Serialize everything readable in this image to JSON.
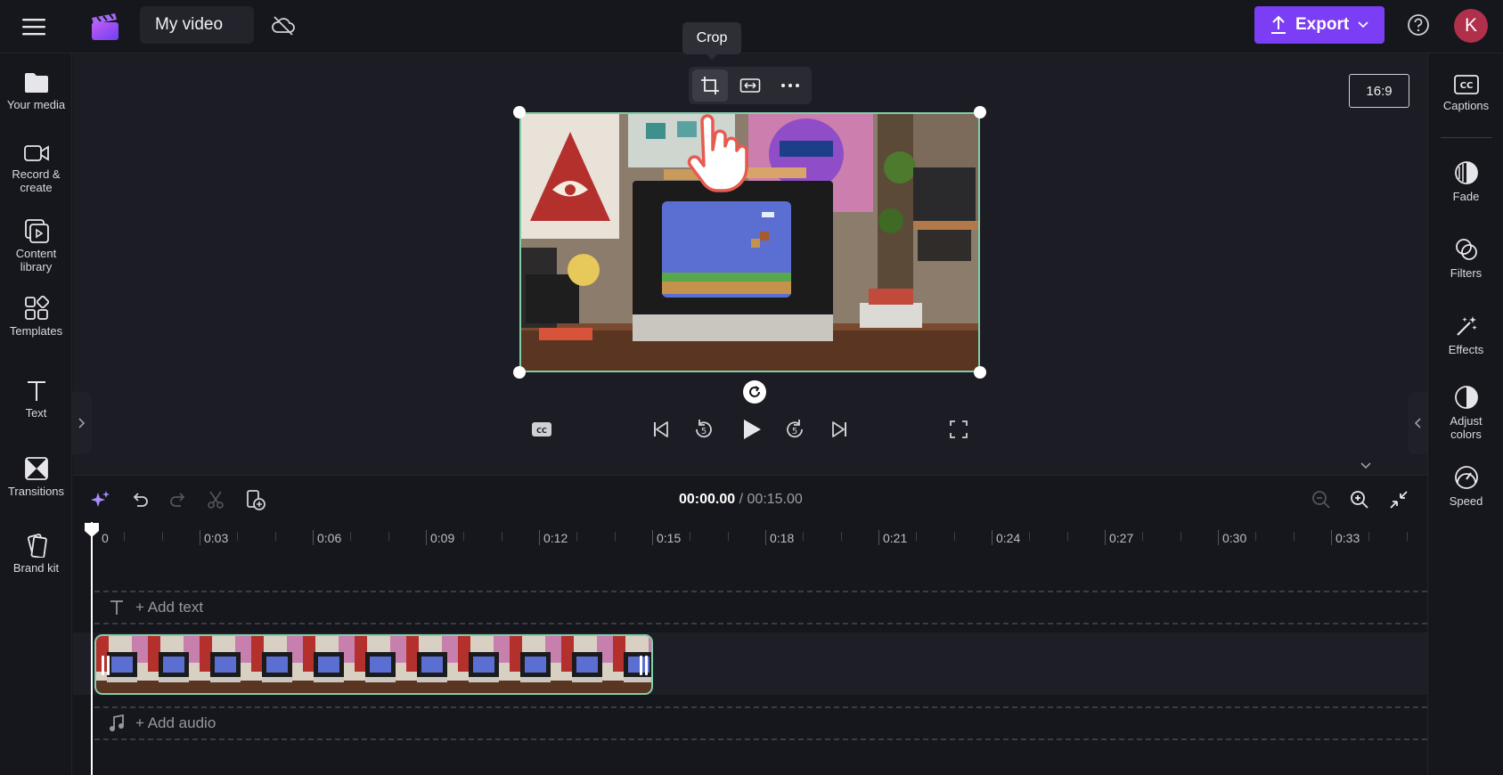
{
  "app": {
    "title": "My video",
    "avatar_initial": "K",
    "export_label": "Export",
    "accent": "#7c3ef4"
  },
  "left_sidebar": {
    "items": [
      {
        "label": "Your media",
        "icon": "folder-icon"
      },
      {
        "label": "Record &\ncreate",
        "icon": "video-camera-icon"
      },
      {
        "label": "Content\nlibrary",
        "icon": "content-library-icon"
      },
      {
        "label": "Templates",
        "icon": "templates-icon"
      },
      {
        "label": "Text",
        "icon": "text-icon"
      },
      {
        "label": "Transitions",
        "icon": "transitions-icon"
      },
      {
        "label": "Brand kit",
        "icon": "brand-kit-icon"
      }
    ]
  },
  "right_sidebar": {
    "items": [
      {
        "label": "Captions",
        "icon": "captions-icon"
      },
      {
        "label": "Fade",
        "icon": "fade-icon"
      },
      {
        "label": "Filters",
        "icon": "filters-icon"
      },
      {
        "label": "Effects",
        "icon": "effects-icon"
      },
      {
        "label": "Adjust\ncolors",
        "icon": "adjust-colors-icon"
      },
      {
        "label": "Speed",
        "icon": "speed-icon"
      }
    ]
  },
  "preview": {
    "aspect_ratio": "16:9",
    "tooltip": "Crop",
    "toolbar": [
      "crop-icon",
      "fit-icon",
      "more-icon"
    ]
  },
  "timeline": {
    "current_time": "00:00.00",
    "separator": " / ",
    "total_time": "00:15.00",
    "ruler_labels": [
      "0",
      "0:03",
      "0:06",
      "0:09",
      "0:12",
      "0:15",
      "0:18",
      "0:21",
      "0:24",
      "0:27",
      "0:30",
      "0:33"
    ],
    "add_text_label": "+ Add text",
    "add_audio_label": "+ Add audio"
  }
}
